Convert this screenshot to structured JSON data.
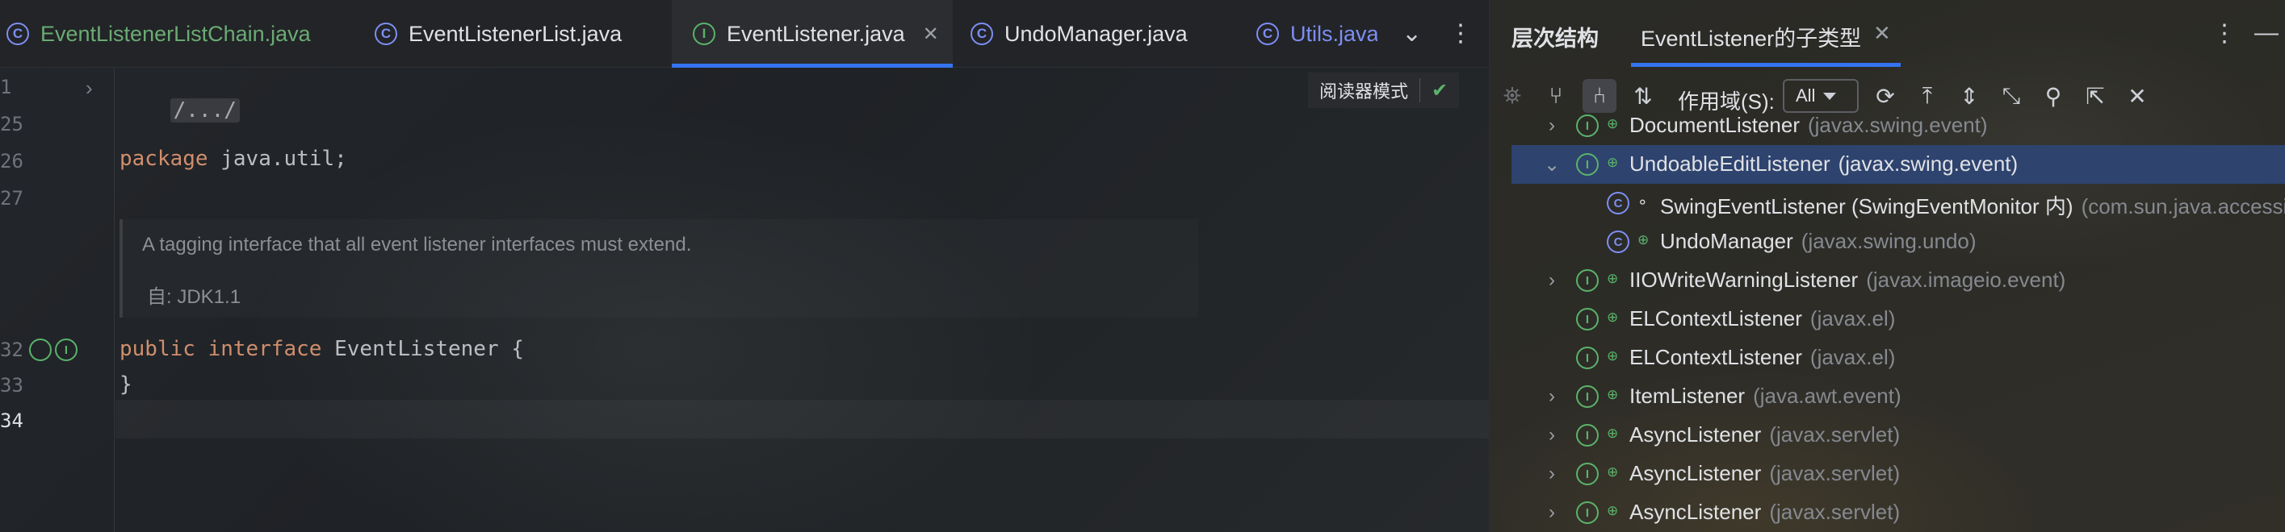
{
  "editor": {
    "tabs": [
      {
        "label": "EventListenerListChain.java",
        "icon": "class-icon",
        "color": "#6aab73"
      },
      {
        "label": "EventListenerList.java",
        "icon": "class-icon"
      },
      {
        "label": "EventListener.java",
        "icon": "interface-icon",
        "active": true
      },
      {
        "label": "UndoManager.java",
        "icon": "class-icon"
      },
      {
        "label": "Utils.java",
        "icon": "class-icon",
        "color": "#7d8ef3"
      }
    ],
    "line_numbers": [
      "1",
      "25",
      "26",
      "27",
      "32",
      "33",
      "34"
    ],
    "code": {
      "folded_header": "/.../",
      "package_kw": "package",
      "package_rest": " java.util;",
      "public_kw": "public",
      "interface_kw": "interface",
      "decl_rest": " EventListener {",
      "closing": "}"
    },
    "doc": {
      "text": "A tagging interface that all event listener interfaces must extend.",
      "since": "自: JDK1.1"
    },
    "reader_mode_label": "阅读器模式"
  },
  "panel": {
    "title": "层次结构",
    "tab_label": "EventListener的子类型",
    "scope_label": "作用域(S):",
    "scope_value": "All",
    "tree": [
      {
        "name": "DocumentListener",
        "pkg": "(javax.swing.event)",
        "icon": "interface-icon",
        "expand": "collapsed",
        "level": 1
      },
      {
        "name": "UndoableEditListener",
        "pkg": "(javax.swing.event)",
        "icon": "interface-icon",
        "expand": "expanded",
        "level": 1,
        "selected": true
      },
      {
        "name": "SwingEventListener (SwingEventMonitor 内)",
        "pkg": "(com.sun.java.accessibility.util)",
        "icon": "class-icon",
        "level": 2
      },
      {
        "name": "UndoManager",
        "pkg": "(javax.swing.undo)",
        "icon": "class-icon",
        "level": 2
      },
      {
        "name": "IIOWriteWarningListener",
        "pkg": "(javax.imageio.event)",
        "icon": "interface-icon",
        "expand": "collapsed",
        "level": 1
      },
      {
        "name": "ELContextListener",
        "pkg": "(javax.el)",
        "icon": "interface-icon",
        "level": 1
      },
      {
        "name": "ELContextListener",
        "pkg": "(javax.el)",
        "icon": "interface-icon",
        "level": 1
      },
      {
        "name": "ItemListener",
        "pkg": "(java.awt.event)",
        "icon": "interface-icon",
        "expand": "collapsed",
        "level": 1
      },
      {
        "name": "AsyncListener",
        "pkg": "(javax.servlet)",
        "icon": "interface-icon",
        "expand": "collapsed",
        "level": 1
      },
      {
        "name": "AsyncListener",
        "pkg": "(javax.servlet)",
        "icon": "interface-icon",
        "expand": "collapsed",
        "level": 1
      },
      {
        "name": "AsyncListener",
        "pkg": "(javax.servlet)",
        "icon": "interface-icon",
        "expand": "collapsed",
        "level": 1
      }
    ]
  },
  "colors": {
    "accent": "#3574f0",
    "selection": "#2e436e",
    "keyword": "#cf8e6d",
    "interface_icon": "#5ab36a",
    "class_icon": "#7d8ef3"
  }
}
